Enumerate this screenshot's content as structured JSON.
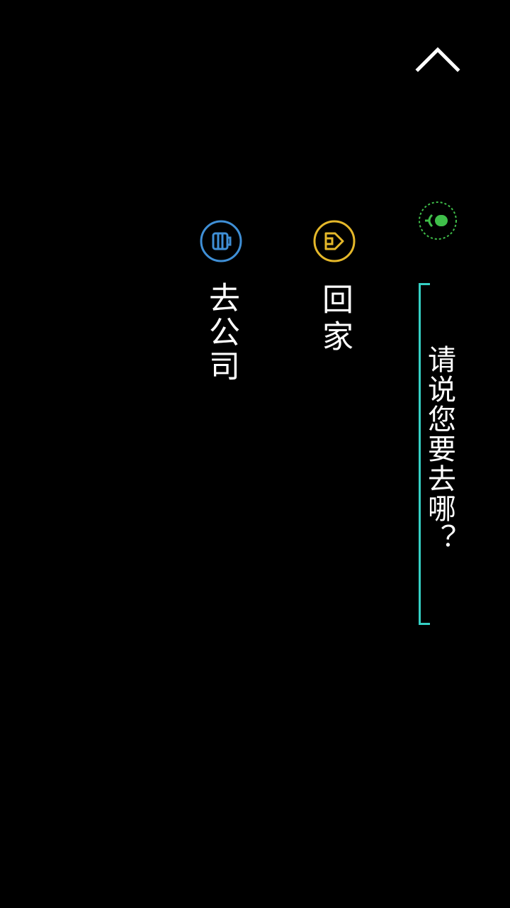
{
  "header": {
    "collapse_icon": "chevron-up-icon"
  },
  "voice": {
    "mic_icon": "microphone-icon",
    "mic_color": "#3fbf4a",
    "prompt": "请说您要去哪？",
    "bracket_color": "#35d0c4"
  },
  "options": [
    {
      "label": "回家",
      "icon": "home-icon",
      "color": "#e5b82a"
    },
    {
      "label": "去公司",
      "icon": "briefcase-icon",
      "color": "#3f8fd6"
    }
  ]
}
